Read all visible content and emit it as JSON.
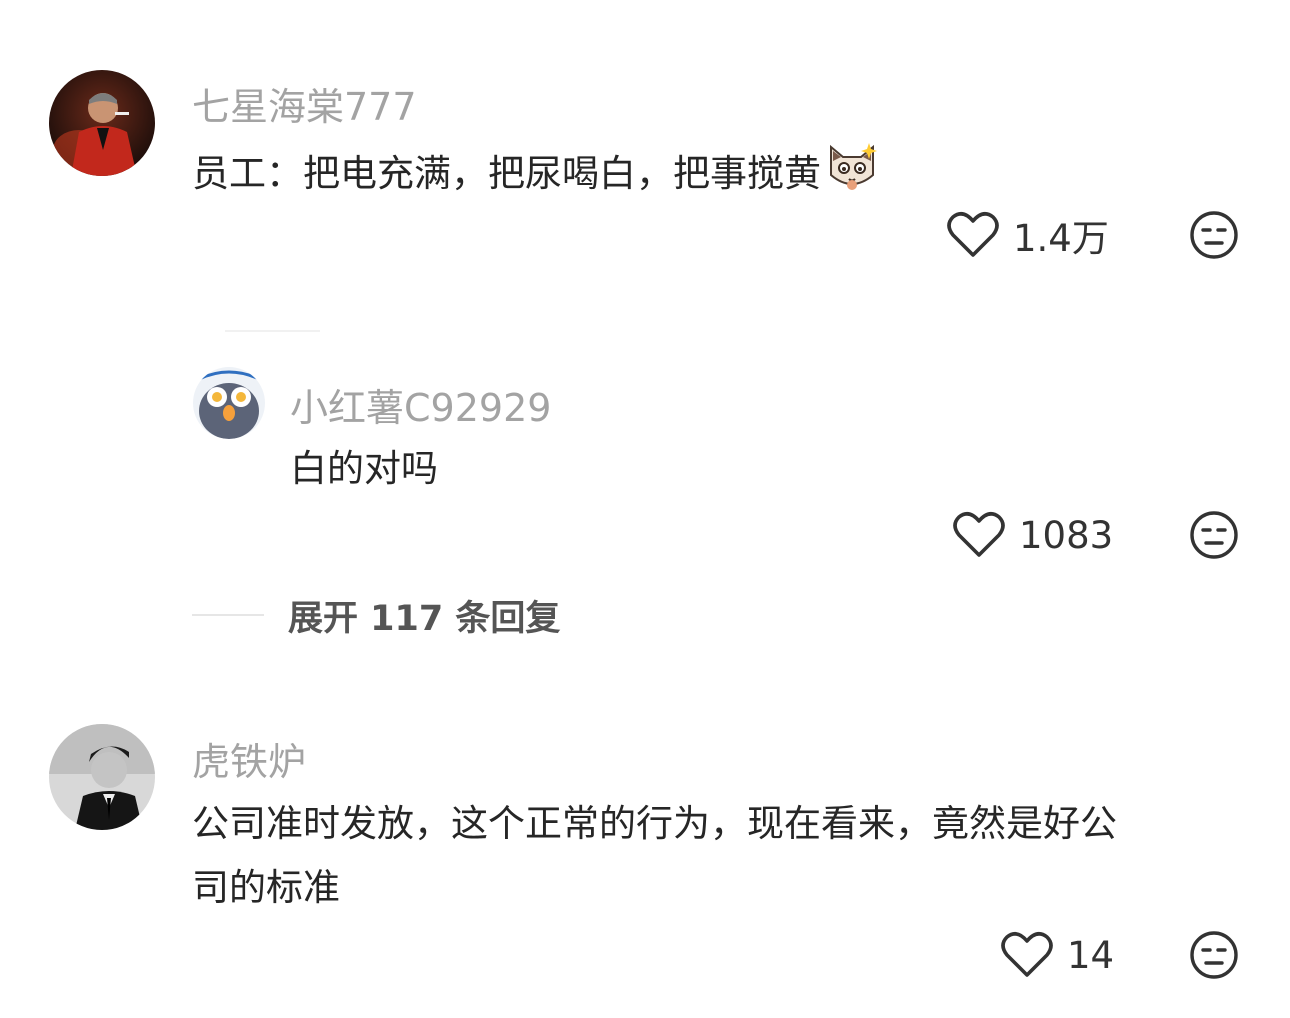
{
  "comments": [
    {
      "username": "七星海棠777",
      "text": "员工：把电充满，把尿喝白，把事搅黄",
      "likes": "1.4万"
    },
    {
      "username": "小红薯C92929",
      "text": "白的对吗",
      "likes": "1083"
    },
    {
      "username": "虎铁炉",
      "text_line1": "公司准时发放，这个正常的行为，现在看来，竟然是好公",
      "text_line2": "司的标准",
      "likes": "14"
    }
  ],
  "expand_replies": "展开 117 条回复",
  "colors": {
    "username": "#a3a3a3",
    "text": "#262626",
    "icon": "#333333"
  },
  "icons": {
    "like": "heart-outline-icon",
    "dislike": "meh-face-icon"
  }
}
